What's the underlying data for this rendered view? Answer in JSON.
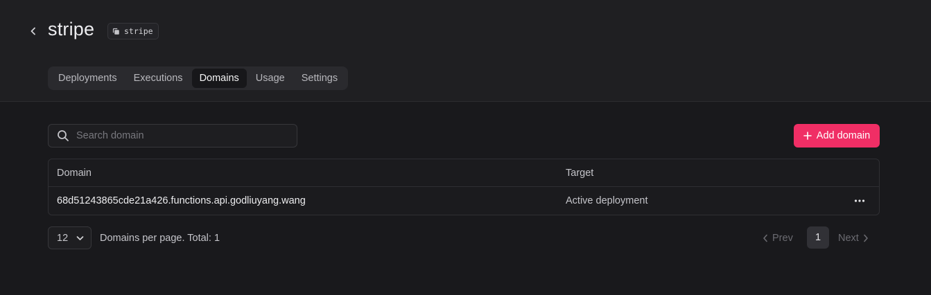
{
  "header": {
    "back_icon": "chevron-left-icon",
    "title": "stripe",
    "id_badge": {
      "icon": "copy-icon",
      "text": "stripe"
    }
  },
  "tabs": [
    {
      "label": "Deployments",
      "active": false
    },
    {
      "label": "Executions",
      "active": false
    },
    {
      "label": "Domains",
      "active": true
    },
    {
      "label": "Usage",
      "active": false
    },
    {
      "label": "Settings",
      "active": false
    }
  ],
  "toolbar": {
    "search": {
      "icon": "search-icon",
      "placeholder": "Search domain",
      "value": ""
    },
    "add_button": {
      "icon": "plus-icon",
      "label": "Add domain"
    }
  },
  "table": {
    "columns": [
      "Domain",
      "Target"
    ],
    "rows": [
      {
        "domain": "68d51243865cde21a426.functions.api.godliuyang.wang",
        "target": "Active deployment",
        "actions_icon": "more-horizontal-icon"
      }
    ]
  },
  "pagination": {
    "per_page": "12",
    "summary": "Domains per page. Total: 1",
    "prev_label": "Prev",
    "next_label": "Next",
    "current_page": "1"
  },
  "colors": {
    "accent": "#f02e65",
    "background": "#19191c",
    "header_background": "#1f1f22"
  }
}
